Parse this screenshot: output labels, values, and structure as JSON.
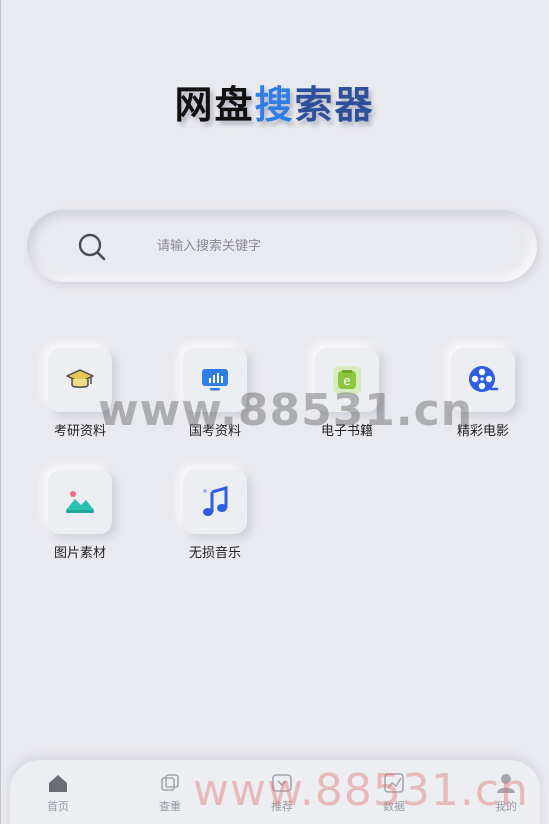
{
  "header": {
    "title_part1": "网盘",
    "title_part2": "搜",
    "title_part3": "索器"
  },
  "search": {
    "placeholder": "请输入搜索关键字",
    "icon": "search-icon"
  },
  "categories": [
    {
      "label": "考研资料",
      "icon": "graduation-cap-icon"
    },
    {
      "label": "国考资料",
      "icon": "presentation-chart-icon"
    },
    {
      "label": "电子书籍",
      "icon": "ebook-icon"
    },
    {
      "label": "精彩电影",
      "icon": "film-reel-icon"
    },
    {
      "label": "图片素材",
      "icon": "image-icon"
    },
    {
      "label": "无损音乐",
      "icon": "music-note-icon"
    }
  ],
  "watermark": {
    "text": "www.88531.cn",
    "text_bottom": "www.88531.cn"
  },
  "tabbar": {
    "tabs": [
      {
        "label": "首页",
        "icon": "home-icon"
      },
      {
        "label": "查重",
        "icon": "copy-check-icon"
      },
      {
        "label": "推荐",
        "icon": "recommend-icon"
      },
      {
        "label": "数据",
        "icon": "data-chart-icon"
      },
      {
        "label": "我的",
        "icon": "user-icon"
      }
    ]
  },
  "colors": {
    "background": "#e9eaef",
    "accent_blue": "#2f7ee8",
    "accent_navy": "#2e4f9a",
    "ebook_green": "#8cc63f",
    "image_teal": "#2cc1b2"
  }
}
